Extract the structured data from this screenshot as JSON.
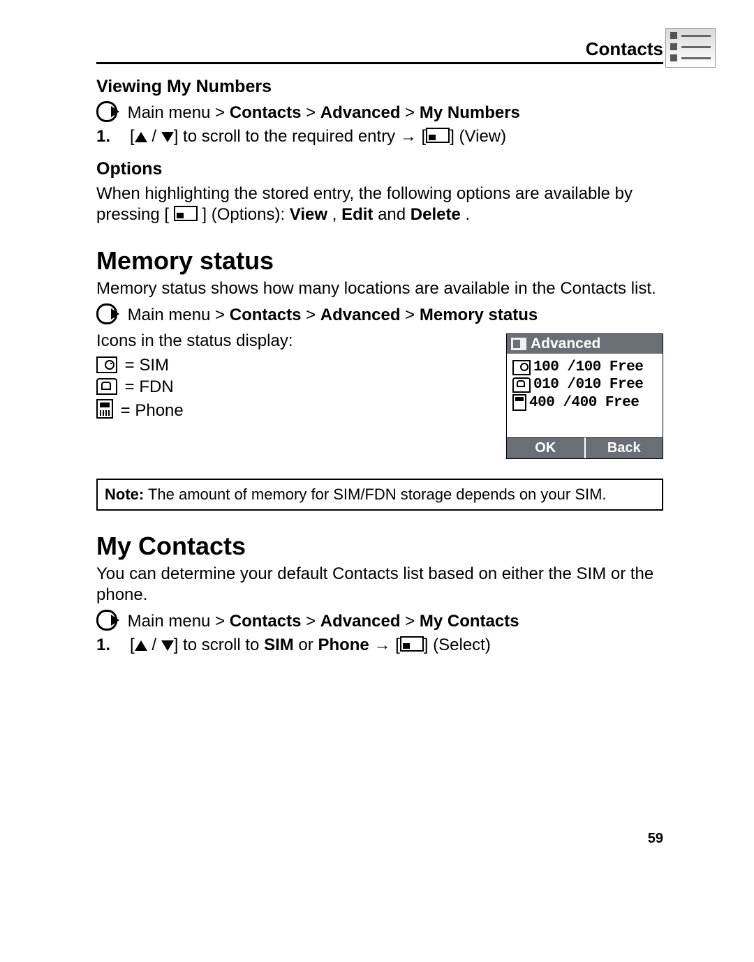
{
  "header": {
    "section": "Contacts"
  },
  "viewing": {
    "heading": "Viewing My Numbers",
    "crumb_lead": "Main menu > ",
    "crumb_b1": "Contacts",
    "crumb_sep1": " > ",
    "crumb_b2": "Advanced",
    "crumb_sep2": " > ",
    "crumb_b3": "My Numbers",
    "step1_num": "1.",
    "step1_a": " to scroll to the required entry ",
    "step1_b": " (View)"
  },
  "options": {
    "heading": "Options",
    "p1a": "When highlighting the stored entry, the following options are available by pressing [",
    "p1b": "] (Options): ",
    "opt1": "View",
    "sep1": ", ",
    "opt2": "Edit",
    "sep2": " and ",
    "opt3": "Delete",
    "tail": "."
  },
  "memstatus": {
    "heading": "Memory status",
    "desc": "Memory status shows how many locations are available in the Contacts list.",
    "crumb_lead": "Main menu > ",
    "crumb_b1": "Contacts",
    "crumb_sep1": " > ",
    "crumb_b2": "Advanced",
    "crumb_sep2": " > ",
    "crumb_b3": "Memory status",
    "icons_line": "Icons in the status display:",
    "legend_sim": " = SIM",
    "legend_fdn": " = FDN",
    "legend_phone": " = Phone"
  },
  "screenshot": {
    "title": "Advanced",
    "rows": {
      "sim": "100  /100 Free",
      "fdn": "010  /010 Free",
      "phone": "400 /400 Free"
    },
    "soft_left": "OK",
    "soft_right": "Back"
  },
  "note": {
    "label": "Note:",
    "text": " The amount of memory for SIM/FDN storage depends on your SIM."
  },
  "mycontacts": {
    "heading": "My Contacts",
    "desc": "You can determine your default Contacts list based on either the SIM or the phone.",
    "crumb_lead": "Main menu > ",
    "crumb_b1": "Contacts",
    "crumb_sep1": " > ",
    "crumb_b2": "Advanced",
    "crumb_sep2": " > ",
    "crumb_b3": "My Contacts",
    "step1_num": "1.",
    "step1_a": " to scroll to ",
    "step1_b1": "SIM",
    "step1_mid": " or ",
    "step1_b2": "Phone",
    "step1_c": " ",
    "step1_d": " (Select)"
  },
  "page_number": "59"
}
